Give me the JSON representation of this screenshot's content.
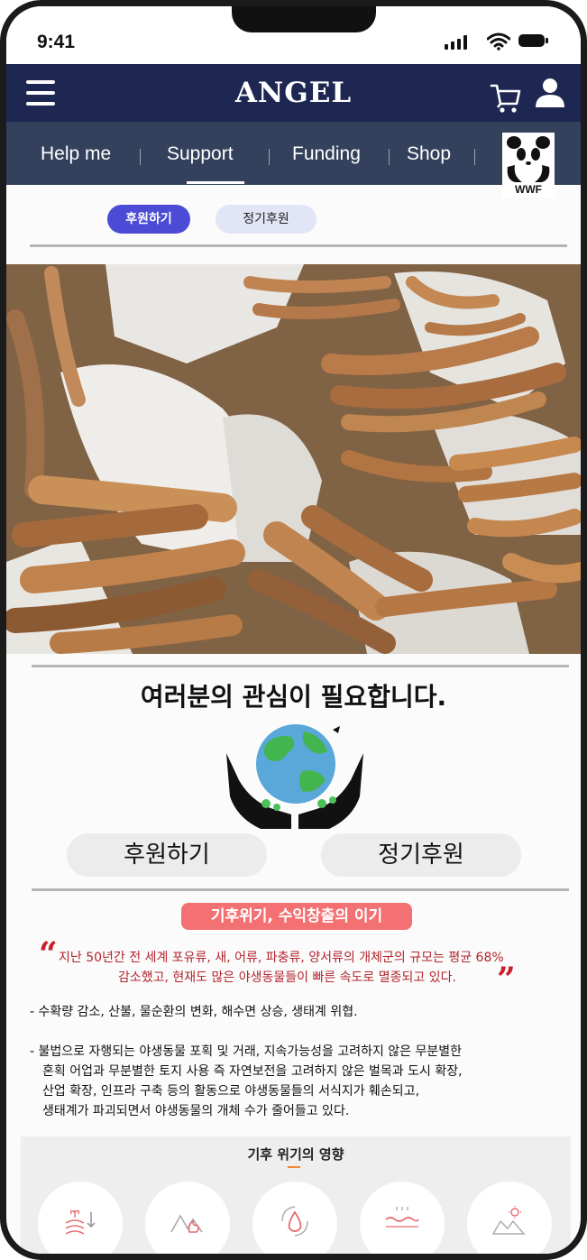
{
  "status_bar": {
    "time": "9:41"
  },
  "header": {
    "logo": "ANGEL"
  },
  "nav": {
    "items": [
      "Help me",
      "Support",
      "Funding",
      "Shop"
    ],
    "active": "Support",
    "partner_logo_text": "WWF"
  },
  "tabs": {
    "donate": "후원하기",
    "regular": "정기후원"
  },
  "main": {
    "headline": "여러분의 관심이 필요합니다.",
    "donate_button": "후원하기",
    "regular_button": "정기후원"
  },
  "crisis": {
    "badge": "기후위기, 수익창출의 이기",
    "quote_line1": "지난 50년간 전 세계 포유류, 새, 어류, 파충류, 양서류의 개체군의 규모는 평균 68%",
    "quote_line2": "감소했고, 현재도 많은 야생동물들이 빠른 속도로 멸종되고 있다.",
    "bullet1": "- 수확량 감소, 산불, 물순환의 변화, 해수면 상승, 생태계 위협.",
    "bullet2_line1": "- 불법으로 자행되는 야생동물 포획 및 거래, 지속가능성을 고려하지 않은 무분별한",
    "bullet2_line2": "혼획 어업과 무분별한 토지 사용 즉 자연보전을 고려하지 않은 벌목과 도시 확장,",
    "bullet2_line3": "산업 확장, 인프라 구축 등의 활동으로 야생동물들의 서식지가 훼손되고,",
    "bullet2_line4": "생태계가 파괴되면서 야생동물의 개체 수가 줄어들고 있다."
  },
  "impact": {
    "title": "기후 위기의 영향",
    "icons": [
      "crop-icon",
      "mountain-fire-icon",
      "water-cycle-icon",
      "sea-level-icon",
      "drought-icon"
    ]
  },
  "colors": {
    "header": "#1e2652",
    "nav": "#33415c",
    "primary_chip": "#4b4bd6",
    "badge": "#f47173",
    "quote": "#b2252d"
  }
}
